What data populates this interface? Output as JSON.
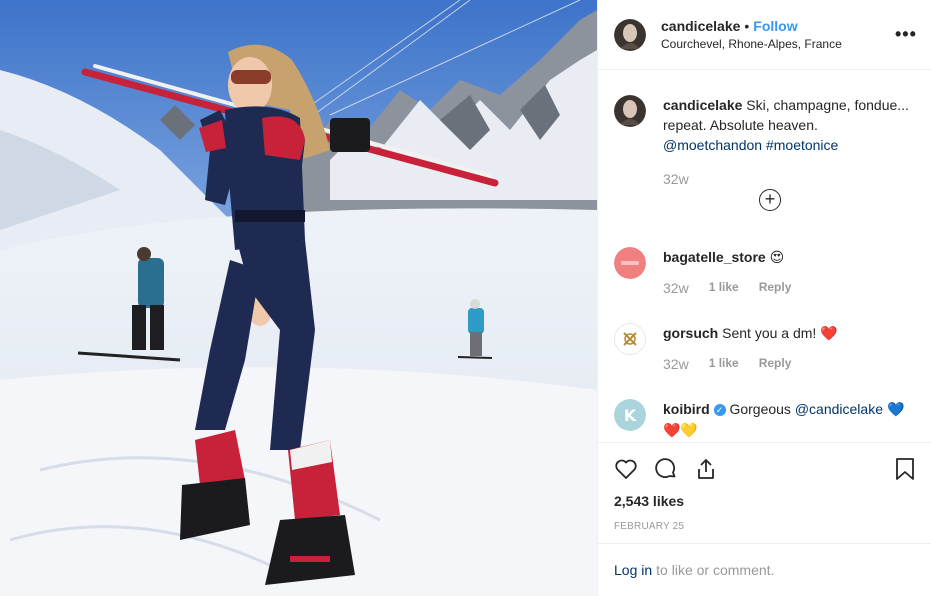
{
  "post": {
    "username": "candicelake",
    "dot": "•",
    "follow_label": "Follow",
    "location": "Courchevel, Rhone-Alpes, France",
    "more_icon": "•••"
  },
  "caption": {
    "username": "candicelake",
    "text": " Ski, champagne, fondue... repeat. Absolute heaven.",
    "mention": "@moetchandon",
    "hashtag": "#moetonice",
    "time": "32w"
  },
  "load_more_icon": "+",
  "comments": [
    {
      "username": "bagatelle_store",
      "text": "",
      "emoji": "😍",
      "time": "32w",
      "likes": "1 like",
      "reply": "Reply"
    },
    {
      "username": "gorsuch",
      "text": " Sent you a dm! ",
      "emoji": "❤️",
      "time": "32w",
      "likes": "1 like",
      "reply": "Reply"
    },
    {
      "username": "koibird",
      "text": " Gorgeous ",
      "mention": "@candicelake",
      "emoji": " 💙",
      "emoji2": "❤️💛"
    }
  ],
  "stats": {
    "likes": "2,543 likes",
    "date": "FEBRUARY 25"
  },
  "login": {
    "link": "Log in",
    "text": "to like or comment."
  },
  "colors": {
    "link_blue": "#3897f0",
    "dark_link": "#003569",
    "muted": "#999999"
  }
}
